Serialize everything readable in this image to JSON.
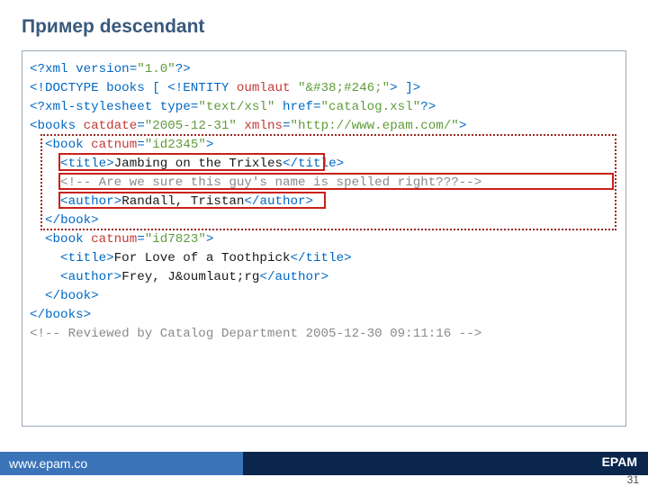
{
  "title": "Пример descendant",
  "code": {
    "l1a": "<?",
    "l1b": "xml version",
    "l1c": "=",
    "l1d": "\"1.0\"",
    "l1e": "?>",
    "l2a": "<!DOCTYPE books [ <!",
    "l2b": "ENTITY",
    "l2c": " oumlaut ",
    "l2d": "\"&#38;#246;\"",
    "l2e": "> ]>",
    "l3a": "<?",
    "l3b": "xml-stylesheet type",
    "l3c": "=",
    "l3d": "\"text/xsl\"",
    "l3e": " href",
    "l3f": "=",
    "l3g": "\"catalog.xsl\"",
    "l3h": "?>",
    "l4a": "<",
    "l4b": "books",
    "l4c": " catdate",
    "l4d": "=",
    "l4e": "\"2005-12-31\"",
    "l4f": " xmlns",
    "l4g": "=",
    "l4h": "\"http://www.epam.com/\"",
    "l4i": ">",
    "l5a": "  <",
    "l5b": "book",
    "l5c": " catnum",
    "l5d": "=",
    "l5e": "\"id2345\"",
    "l5f": ">",
    "l6a": "    <",
    "l6b": "title",
    "l6c": ">",
    "l6d": "Jambing on the Trixles",
    "l6e": "</",
    "l6f": "title",
    "l6g": ">",
    "l7a": "    <!-- Are we sure this guy's name is spelled right???-->",
    "l8a": "    <",
    "l8b": "author",
    "l8c": ">",
    "l8d": "Randall, Tristan",
    "l8e": "</",
    "l8f": "author",
    "l8g": ">",
    "l9a": "  </",
    "l9b": "book",
    "l9c": ">",
    "l10a": "  <",
    "l10b": "book",
    "l10c": " catnum",
    "l10d": "=",
    "l10e": "\"id7823\"",
    "l10f": ">",
    "l11a": "    <",
    "l11b": "title",
    "l11c": ">",
    "l11d": "For Love of a Toothpick",
    "l11e": "</",
    "l11f": "title",
    "l11g": ">",
    "l12a": "    <",
    "l12b": "author",
    "l12c": ">",
    "l12d": "Frey, J&oumlaut;rg",
    "l12e": "</",
    "l12f": "author",
    "l12g": ">",
    "l13a": "  </",
    "l13b": "book",
    "l13c": ">",
    "l14a": "</",
    "l14b": "books",
    "l14c": ">",
    "l15a": "<!-- Reviewed by Catalog Department 2005-12-30 09:11:16 -->"
  },
  "footer": {
    "url": "www.epam.co",
    "brand": "EPAM"
  },
  "page_number": "31"
}
